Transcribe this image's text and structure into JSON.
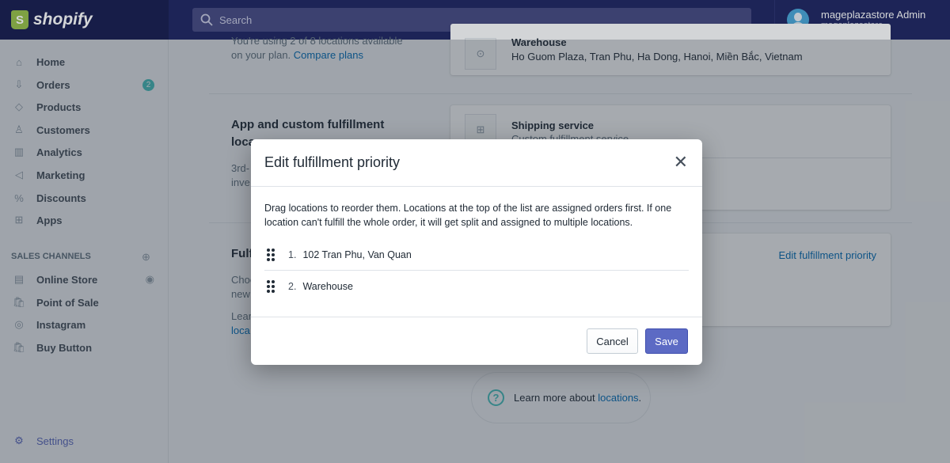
{
  "topbar": {
    "brand": "shopify",
    "search_placeholder": "Search",
    "user_name": "mageplazastore Admin",
    "store_name": "mageplazastore"
  },
  "sidebar": {
    "items": [
      {
        "label": "Home",
        "icon": "home-icon"
      },
      {
        "label": "Orders",
        "icon": "orders-icon",
        "badge": "2"
      },
      {
        "label": "Products",
        "icon": "tag-icon"
      },
      {
        "label": "Customers",
        "icon": "person-icon"
      },
      {
        "label": "Analytics",
        "icon": "bar-chart-icon"
      },
      {
        "label": "Marketing",
        "icon": "megaphone-icon"
      },
      {
        "label": "Discounts",
        "icon": "discount-icon"
      },
      {
        "label": "Apps",
        "icon": "apps-icon"
      }
    ],
    "sales_channels_heading": "SALES CHANNELS",
    "channels": [
      {
        "label": "Online Store"
      },
      {
        "label": "Point of Sale"
      },
      {
        "label": "Instagram"
      },
      {
        "label": "Buy Button"
      }
    ],
    "settings": "Settings"
  },
  "main": {
    "plan_text": "You're using 2 of 8 locations available",
    "plan_text2": "on your plan.",
    "compare_plans": "Compare plans",
    "warehouse_card": {
      "name": "Warehouse",
      "address": "Ho Guom Plaza, Tran Phu, Ha Dong, Hanoi, Miền Bắc, Vietnam"
    },
    "app_section": {
      "title1": "App and custom fulfillment",
      "title2": "loca",
      "desc1": "3rd-",
      "desc2": "inve"
    },
    "shipping_card": {
      "name": "Shipping service",
      "desc": "Custom fulfillment service"
    },
    "fulfill_section": {
      "title": "Fulf",
      "desc1": "Choo",
      "desc2": "new",
      "learn1": "Lear",
      "learn2": "loca"
    },
    "edit_priority_link": "Edit fulfillment priority",
    "learn_more": {
      "prefix": "Learn more about ",
      "link": "locations",
      "suffix": "."
    }
  },
  "modal": {
    "title": "Edit fulfillment priority",
    "description": "Drag locations to reorder them. Locations at the top of the list are assigned orders first. If one location can't fulfill the whole order, it will get split and assigned to multiple locations.",
    "locations": [
      {
        "num": "1.",
        "name": "102 Tran Phu, Van Quan"
      },
      {
        "num": "2.",
        "name": "Warehouse"
      }
    ],
    "cancel": "Cancel",
    "save": "Save"
  },
  "colors": {
    "topbar": "#1c2260",
    "primary": "#5c6ac4",
    "link": "#006fbb",
    "badge": "#47c1bf"
  }
}
